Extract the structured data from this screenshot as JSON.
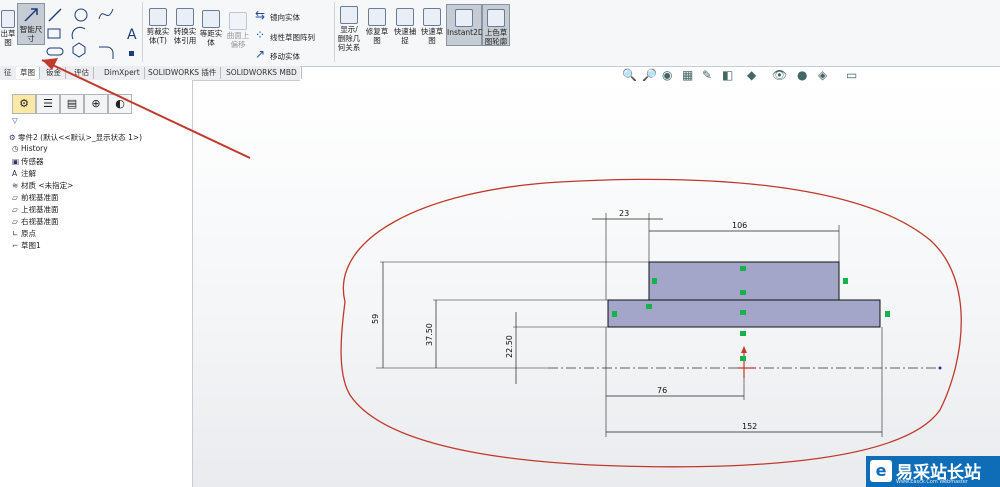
{
  "ribbon": {
    "exit_sketch": "出草\n图",
    "smart_dim": "智能尺\n寸",
    "trim": "剪裁实\n体(T)",
    "convert": "转换实\n体引用",
    "offset": "等距实\n体",
    "surface_offset": "曲面上\n偏移",
    "mirror": "镜向实体",
    "linear_pattern": "线性草图阵列",
    "move": "移动实体",
    "display_delete": "显示/\n删除几\n何关系",
    "repair": "修复草\n图",
    "quick_snap": "快速捕\n捉",
    "rapid_sketch": "快速草\n图",
    "instant2d": "Instant2D",
    "shaded_contour": "上色草\n图轮廓"
  },
  "tabs": [
    "征",
    "草图",
    "钣金",
    "评估",
    "DimXpert",
    "SOLIDWORKS 插件",
    "SOLIDWORKS MBD"
  ],
  "active_tab": "草图",
  "feature_tree": {
    "root": "零件2 (默认<<默认>_显示状态 1>)",
    "items": [
      "History",
      "传感器",
      "注解",
      "材质 <未指定>",
      "前视基准面",
      "上视基准面",
      "右视基准面",
      "原点",
      "草图1"
    ]
  },
  "dimensions": {
    "top_left": "23",
    "top_width": "106",
    "height_total": "59",
    "height_mid": "37.50",
    "height_low": "22.50",
    "bottom_half": "76",
    "bottom_width": "152"
  },
  "watermark": {
    "title": "易采站长站",
    "sub": "Www.Easck.Com Webmaster"
  },
  "colors": {
    "sketch_fill": "#a3a6c8",
    "annotation": "#c0392b",
    "relation_green": "#16b34a",
    "accent_blue": "#0f6db8"
  }
}
